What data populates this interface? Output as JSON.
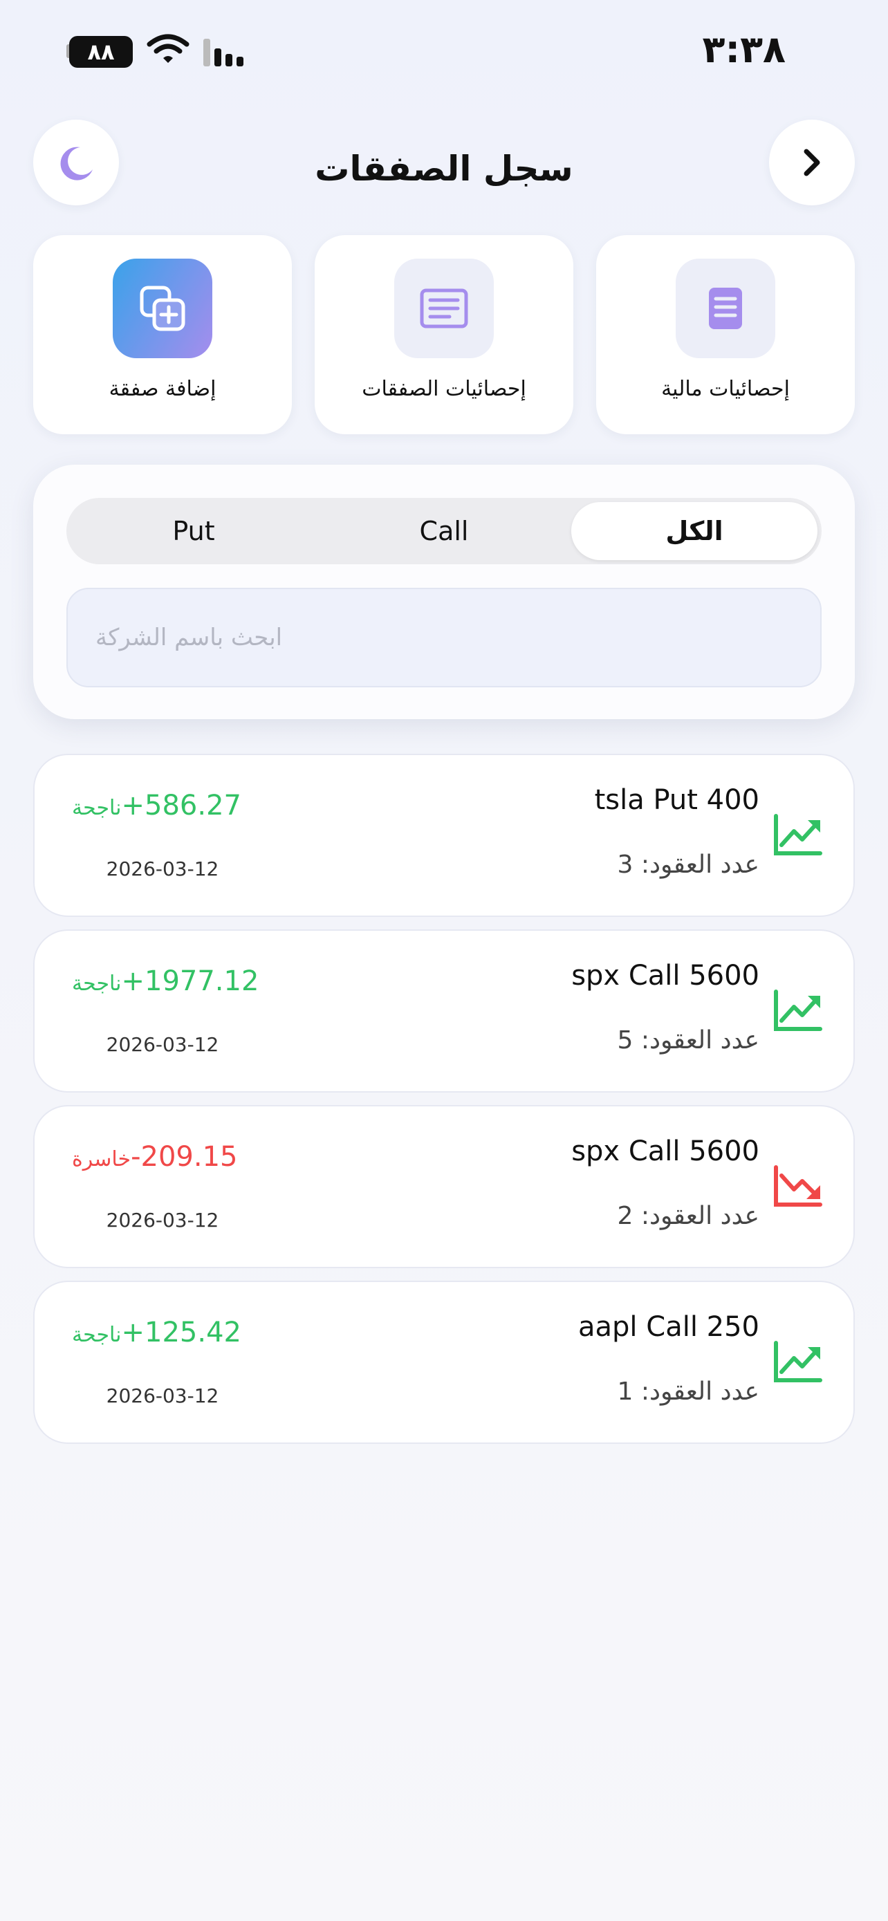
{
  "status_bar": {
    "time": "٣:٣٨",
    "battery": "٨٨"
  },
  "header": {
    "title": "سجل الصفقات"
  },
  "tiles": [
    {
      "label": "إضافة صفقة",
      "icon": "add-copy-icon"
    },
    {
      "label": "إحصائيات الصفقات",
      "icon": "list-icon"
    },
    {
      "label": "إحصائيات مالية",
      "icon": "document-icon"
    }
  ],
  "filter": {
    "segments": {
      "all": "الكل",
      "call": "Call",
      "put": "Put"
    },
    "selected": "الكل",
    "search_placeholder": "ابحث باسم الشركة"
  },
  "trades": [
    {
      "name": "tsla Put 400",
      "contracts": "عدد العقود: 3",
      "amount": "+586.27",
      "status": "ناجحة",
      "date": "2026-03-12",
      "trend": "up"
    },
    {
      "name": "spx Call 5600",
      "contracts": "عدد العقود: 5",
      "amount": "+1977.12",
      "status": "ناجحة",
      "date": "2026-03-12",
      "trend": "up"
    },
    {
      "name": "spx Call 5600",
      "contracts": "عدد العقود: 2",
      "amount": "-209.15",
      "status": "خاسرة",
      "date": "2026-03-12",
      "trend": "down"
    },
    {
      "name": "aapl Call 250",
      "contracts": "عدد العقود: 1",
      "amount": "+125.42",
      "status": "ناجحة",
      "date": "2026-03-12",
      "trend": "up"
    }
  ],
  "colors": {
    "profit": "#32c164",
    "loss": "#f04848",
    "accent": "#a58ded"
  }
}
